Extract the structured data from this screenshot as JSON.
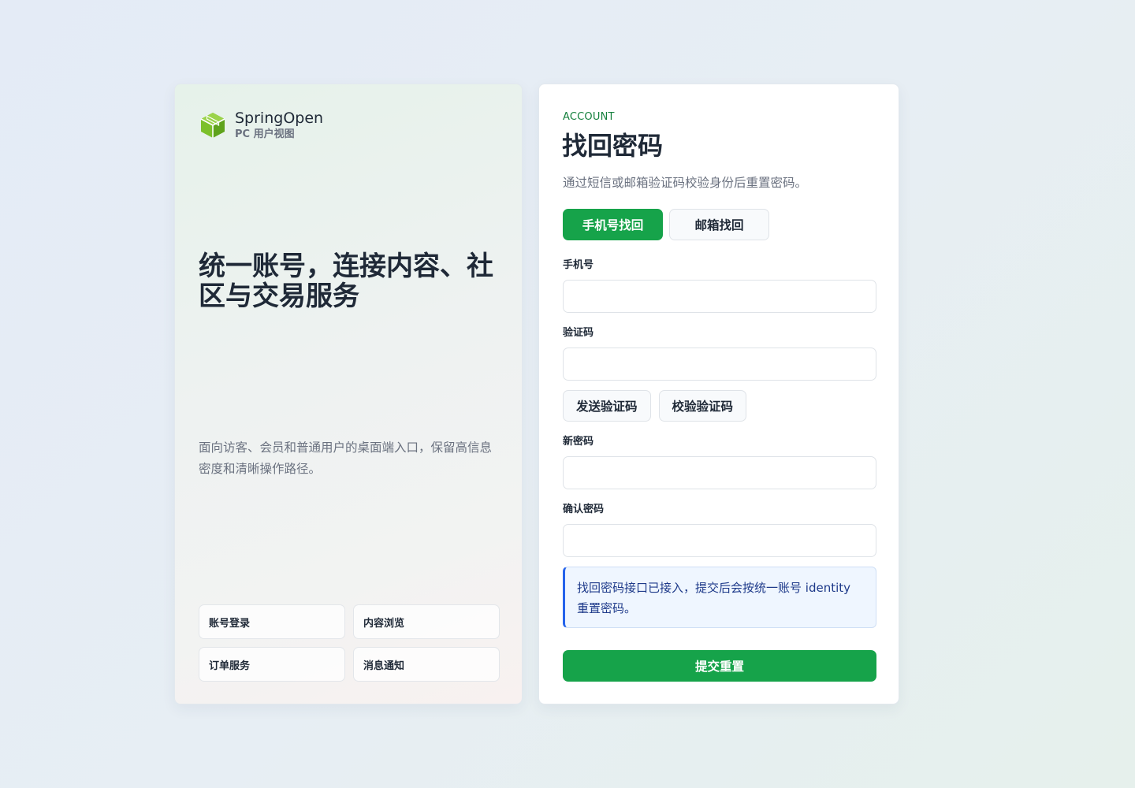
{
  "brand": {
    "name": "SpringOpen",
    "subtitle": "PC 用户视图"
  },
  "hero": {
    "title": "统一账号，连接内容、社区与交易服务",
    "description": "面向访客、会员和普通用户的桌面端入口，保留高信息密度和清晰操作路径。"
  },
  "features": [
    {
      "label": "账号登录"
    },
    {
      "label": "内容浏览"
    },
    {
      "label": "订单服务"
    },
    {
      "label": "消息通知"
    }
  ],
  "form": {
    "eyebrow": "ACCOUNT",
    "title": "找回密码",
    "subtitle": "通过短信或邮箱验证码校验身份后重置密码。",
    "tabs": [
      {
        "label": "手机号找回",
        "active": true
      },
      {
        "label": "邮箱找回",
        "active": false
      }
    ],
    "fields": {
      "phone": {
        "label": "手机号",
        "value": "",
        "placeholder": ""
      },
      "code": {
        "label": "验证码",
        "value": "",
        "placeholder": ""
      },
      "new_password": {
        "label": "新密码",
        "value": "",
        "placeholder": ""
      },
      "confirm_password": {
        "label": "确认密码",
        "value": "",
        "placeholder": ""
      }
    },
    "send_code_label": "发送验证码",
    "verify_code_label": "校验验证码",
    "notice": "找回密码接口已接入，提交后会按统一账号 identity 重置密码。",
    "submit_label": "提交重置"
  },
  "colors": {
    "primary": "#16a34a",
    "eyebrow": "#15803d",
    "notice_accent": "#2563eb",
    "notice_bg": "#eff6ff",
    "logo": "#7cc02a"
  },
  "icons": {
    "brand_logo": "cube-icon"
  }
}
